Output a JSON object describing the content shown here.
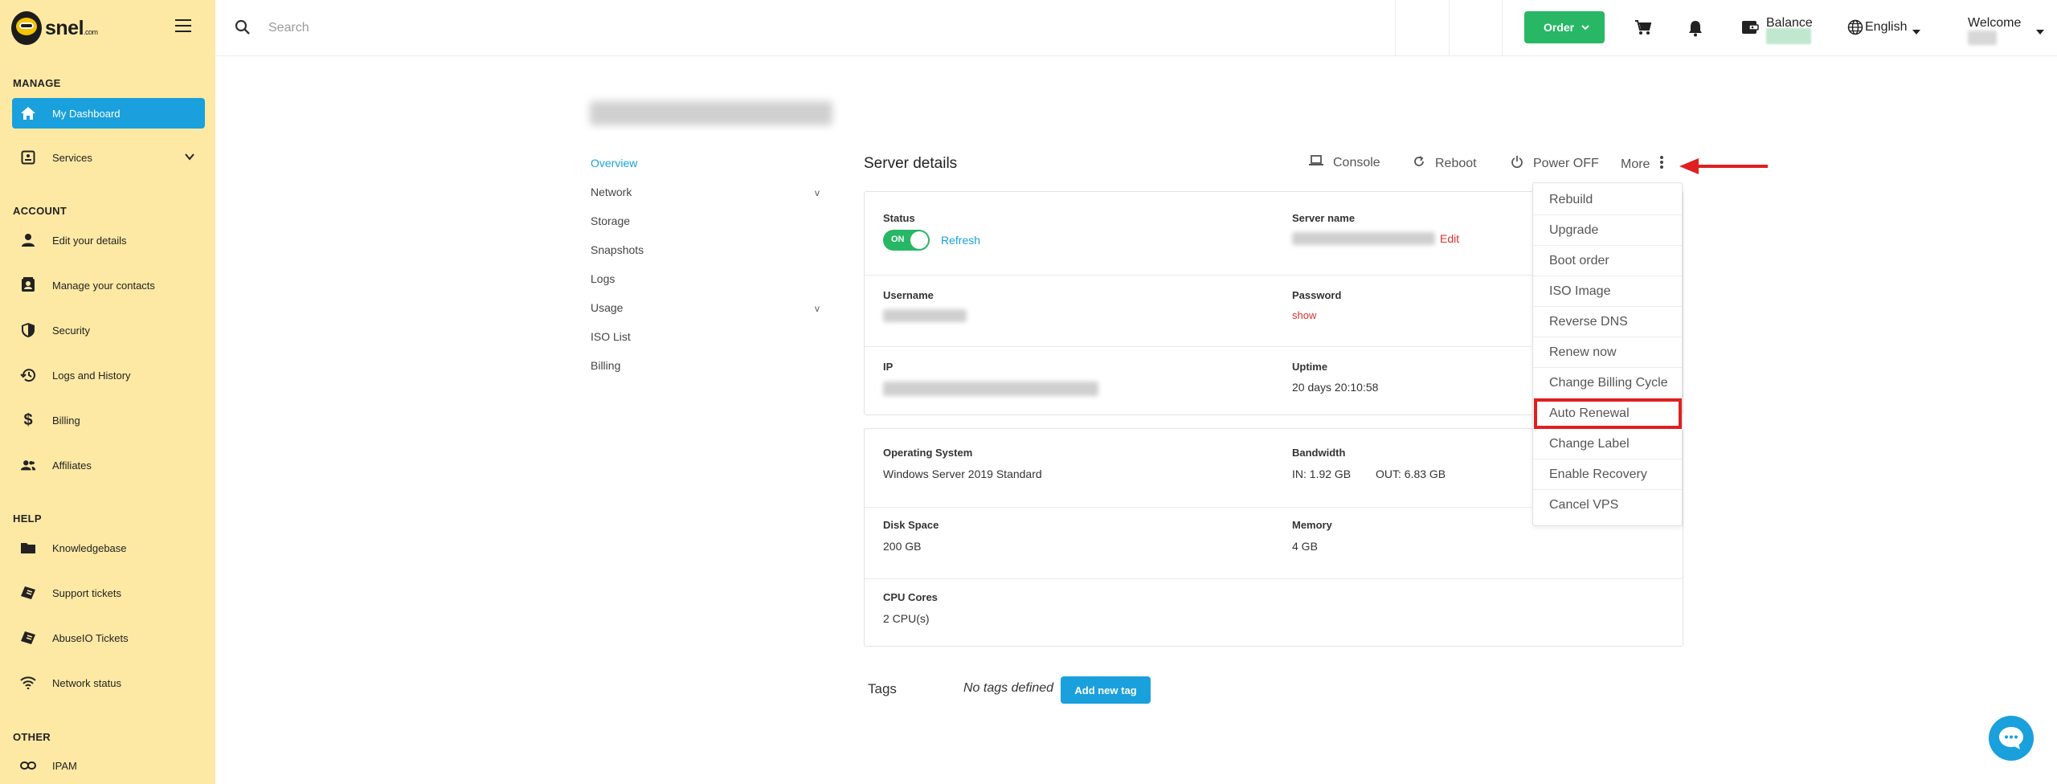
{
  "app": {
    "logo_text": "snel",
    "logo_suffix": ".com"
  },
  "sidebar": {
    "sections": {
      "manage": "MANAGE",
      "account": "ACCOUNT",
      "help": "HELP",
      "other": "OTHER"
    },
    "items": [
      {
        "label": "My Dashboard",
        "icon": "home-icon",
        "active": true
      },
      {
        "label": "Services",
        "icon": "services-icon"
      },
      {
        "label": "Edit your details",
        "icon": "person-icon"
      },
      {
        "label": "Manage your contacts",
        "icon": "contacts-icon"
      },
      {
        "label": "Security",
        "icon": "shield-icon"
      },
      {
        "label": "Logs and History",
        "icon": "history-icon"
      },
      {
        "label": "Billing",
        "icon": "dollar-icon"
      },
      {
        "label": "Affiliates",
        "icon": "affiliates-icon"
      },
      {
        "label": "Knowledgebase",
        "icon": "folder-icon"
      },
      {
        "label": "Support tickets",
        "icon": "tickets-icon"
      },
      {
        "label": "AbuseIO Tickets",
        "icon": "tickets-icon"
      },
      {
        "label": "Network status",
        "icon": "wifi-icon"
      },
      {
        "label": "IPAM",
        "icon": "link-icon"
      }
    ]
  },
  "topbar": {
    "search_placeholder": "Search",
    "order_label": "Order",
    "balance_label": "Balance",
    "language": "English",
    "welcome_label": "Welcome"
  },
  "subnav": {
    "items": [
      "Overview",
      "Network",
      "Storage",
      "Snapshots",
      "Logs",
      "Usage",
      "ISO List",
      "Billing"
    ],
    "expand_marker": "v"
  },
  "server": {
    "title": "Server details",
    "actions": {
      "console": "Console",
      "reboot": "Reboot",
      "power_off": "Power OFF",
      "more": "More"
    },
    "status_label": "Status",
    "status_toggle": "ON",
    "refresh_label": "Refresh",
    "server_name_label": "Server name",
    "edit_label": "Edit",
    "username_label": "Username",
    "password_label": "Password",
    "password_show": "show",
    "ip_label": "IP",
    "uptime_label": "Uptime",
    "uptime_value": "20 days 20:10:58",
    "os_label": "Operating System",
    "os_value": "Windows Server 2019 Standard",
    "bandwidth_label": "Bandwidth",
    "bandwidth_in": "IN: 1.92 GB",
    "bandwidth_out": "OUT: 6.83 GB",
    "disk_label": "Disk Space",
    "disk_value": "200 GB",
    "memory_label": "Memory",
    "memory_value": "4 GB",
    "cpu_label": "CPU Cores",
    "cpu_value": "2 CPU(s)"
  },
  "more_menu": {
    "items": [
      "Rebuild",
      "Upgrade",
      "Boot order",
      "ISO Image",
      "Reverse DNS",
      "Renew now",
      "Change Billing Cycle",
      "Auto Renewal",
      "Change Label",
      "Enable Recovery",
      "Cancel VPS"
    ],
    "highlighted": "Auto Renewal"
  },
  "tags": {
    "label": "Tags",
    "empty_text": "No tags defined",
    "add_button": "Add new tag"
  },
  "colors": {
    "sidebar_bg": "#fde9a4",
    "accent_blue": "#1aa0dc",
    "accent_green": "#27b765",
    "highlight_red": "#e02020"
  }
}
